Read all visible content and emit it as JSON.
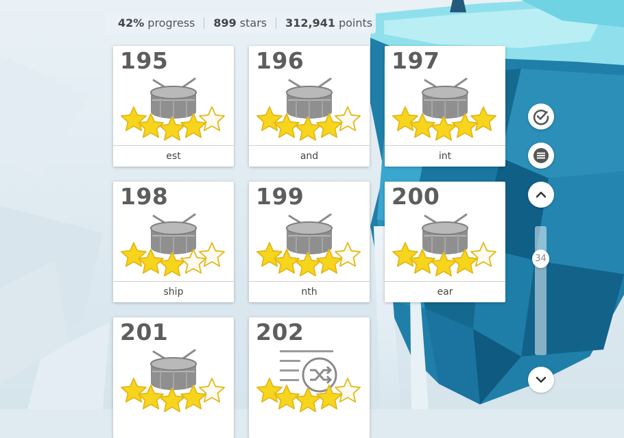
{
  "status": {
    "progress_value": "42%",
    "progress_label": "progress",
    "stars_value": "899",
    "stars_label": "stars",
    "points_value": "312,941",
    "points_label": "points"
  },
  "levels": [
    {
      "number": "195",
      "label": "est",
      "stars": 4,
      "icon": "drum-icon"
    },
    {
      "number": "196",
      "label": "and",
      "stars": 4,
      "icon": "drum-icon"
    },
    {
      "number": "197",
      "label": "int",
      "stars": 5,
      "icon": "drum-icon"
    },
    {
      "number": "198",
      "label": "ship",
      "stars": 3,
      "icon": "drum-icon"
    },
    {
      "number": "199",
      "label": "nth",
      "stars": 4,
      "icon": "drum-icon"
    },
    {
      "number": "200",
      "label": "ear",
      "stars": 4,
      "icon": "drum-icon"
    },
    {
      "number": "201",
      "label": "",
      "stars": 4,
      "icon": "drum-icon"
    },
    {
      "number": "202",
      "label": "",
      "stars": 4,
      "icon": "shuffle-list-icon"
    }
  ],
  "sidebar": {
    "check_icon": "check-circle-icon",
    "menu_icon": "menu-icon",
    "up_icon": "chevron-up-icon",
    "down_icon": "chevron-down-icon",
    "scroll_position": "34"
  },
  "colors": {
    "star_fill": "#f7d51d",
    "star_outline": "#e3b817",
    "drum": "#9a9a9a",
    "island": "#1f7fa8"
  }
}
